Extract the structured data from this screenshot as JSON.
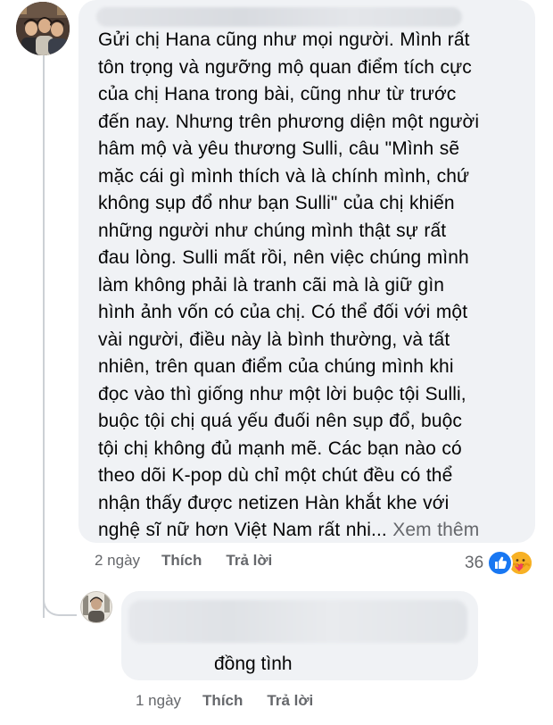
{
  "main_comment": {
    "text_lines": [
      "Gửi chị Hana cũng như mọi người. Mình rất",
      "tôn trọng và ngưỡng mộ quan điểm tích cực",
      "của chị Hana trong bài, cũng như từ trước",
      "đến nay. Nhưng trên phương diện một người",
      "hâm mộ và yêu thương Sulli, câu \"Mình sẽ",
      "mặc cái gì mình thích và là chính mình, chứ",
      "không sụp đổ như bạn Sulli\" của chị khiến",
      "những người như chúng mình thật sự rất",
      "đau lòng. Sulli mất rồi, nên việc chúng mình",
      "làm không phải là tranh cãi mà là giữ gìn",
      "hình ảnh vốn có của chị. Có thể đối với một",
      "vài người, điều này là bình thường, và tất",
      "nhiên, trên quan điểm của chúng mình khi",
      "đọc vào thì giống như một lời buộc tội Sulli,",
      "buộc tội chị quá yếu đuối nên sụp đổ, buộc",
      "tội chị không đủ mạnh mẽ. Các bạn nào có",
      "theo dõi K-pop dù chỉ một chút đều có thể",
      "nhận thấy được netizen Hàn khắt khe với"
    ],
    "last_line": "nghệ sĩ nữ hơn Việt Nam rất nhi...",
    "see_more": "Xem thêm",
    "time": "2 ngày",
    "like_label": "Thích",
    "reply_label": "Trả lời",
    "reaction_count": "36",
    "reaction_icons": [
      "like-icon",
      "care-icon"
    ]
  },
  "reply_comment": {
    "text": "đồng tình",
    "time": "1 ngày",
    "like_label": "Thích",
    "reply_label": "Trả lời"
  },
  "colors": {
    "bubble": "#f0f2f5",
    "text": "#050505",
    "secondary": "#65676b",
    "like_blue": "#1877f2",
    "care_yellow": "#f7b125"
  }
}
